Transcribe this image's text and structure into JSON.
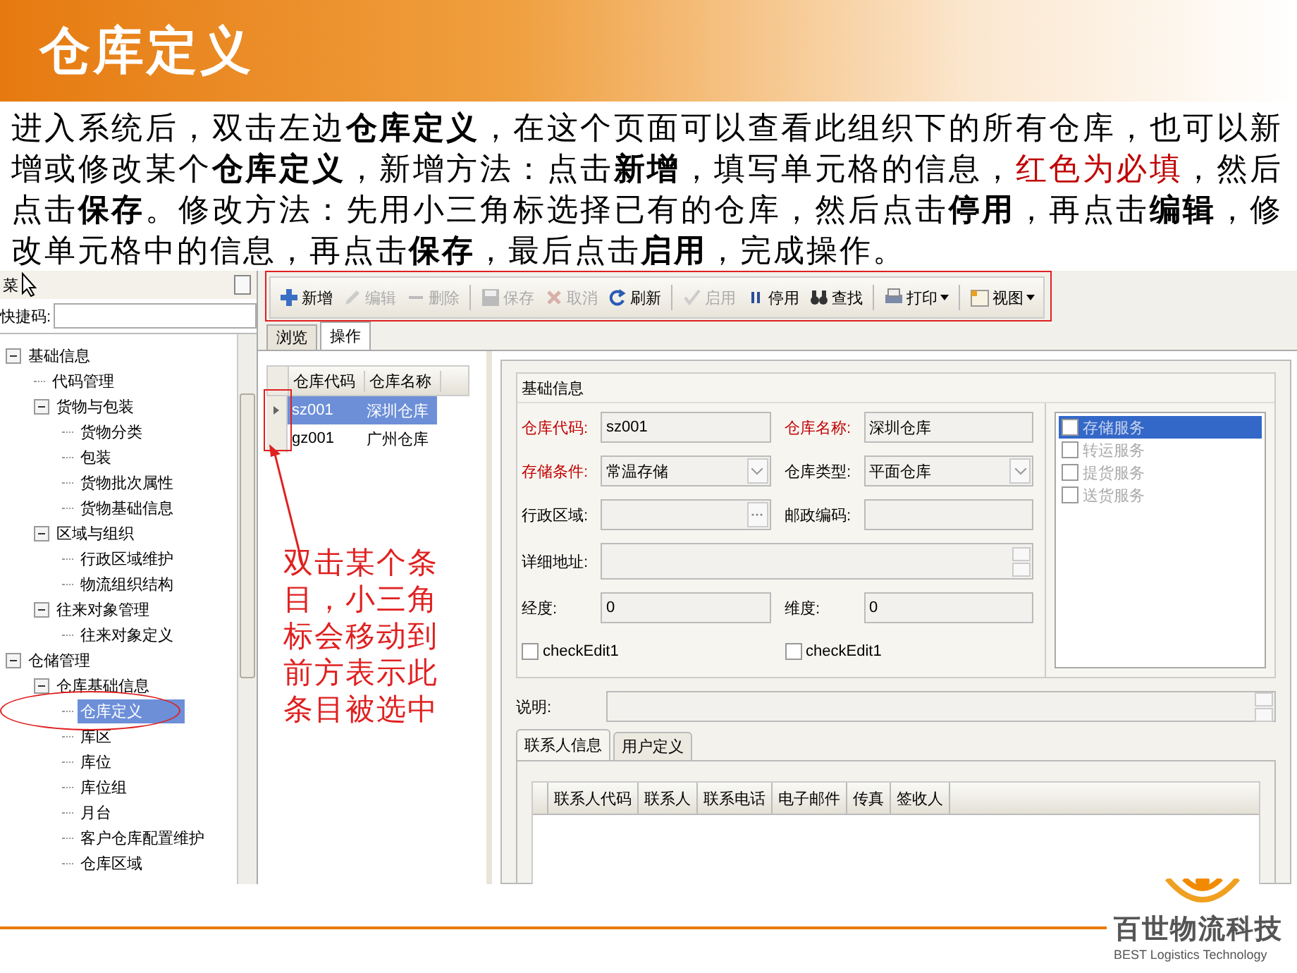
{
  "slide_title": "仓库定义",
  "instructions": [
    {
      "kind": "normal",
      "text": "进入系统后，双击左边**仓库定义**，在这个页面可以查看此组织下的所有仓库，也可以新增或修改某个**仓库定义**，新增方法：点击**新增**，填写单元格的信息，"
    },
    {
      "kind": "required",
      "text": "红色为必填"
    },
    {
      "kind": "normal",
      "text": "，然后点击**保存**。修改方法：先用小三角标选择已有的仓库，然后点击**停用**，再点击**编辑**，修改单元格中的信息，再点击**保存**，最后点击**启用**，完成操作。"
    }
  ],
  "sidebar": {
    "title": "菜",
    "shortcut_label": "快捷码:",
    "tree": [
      {
        "label": "基础信息",
        "expanded": true,
        "selected": false,
        "children": [
          {
            "label": "代码管理",
            "selected": false
          },
          {
            "label": "货物与包装",
            "expanded": true,
            "selected": false,
            "children": [
              {
                "label": "货物分类",
                "selected": false
              },
              {
                "label": "包装",
                "selected": false
              },
              {
                "label": "货物批次属性",
                "selected": false
              },
              {
                "label": "货物基础信息",
                "selected": false
              }
            ]
          },
          {
            "label": "区域与组织",
            "expanded": true,
            "selected": false,
            "children": [
              {
                "label": "行政区域维护",
                "selected": false
              },
              {
                "label": "物流组织结构",
                "selected": false
              }
            ]
          },
          {
            "label": "往来对象管理",
            "expanded": true,
            "selected": false,
            "children": [
              {
                "label": "往来对象定义",
                "selected": false
              }
            ]
          }
        ]
      },
      {
        "label": "仓储管理",
        "expanded": true,
        "selected": false,
        "children": [
          {
            "label": "仓库基础信息",
            "expanded": true,
            "selected": false,
            "children": [
              {
                "label": "仓库定义",
                "selected": true
              },
              {
                "label": "库区",
                "selected": false
              },
              {
                "label": "库位",
                "selected": false
              },
              {
                "label": "库位组",
                "selected": false
              },
              {
                "label": "月台",
                "selected": false
              },
              {
                "label": "客户仓库配置维护",
                "selected": false
              },
              {
                "label": "仓库区域",
                "selected": false
              }
            ]
          }
        ]
      }
    ]
  },
  "toolbar": [
    {
      "kind": "plus",
      "label": "新增",
      "disabled": false
    },
    {
      "kind": "pencil",
      "label": "编辑",
      "disabled": true
    },
    {
      "kind": "minus",
      "label": "删除",
      "disabled": true
    },
    {
      "kind": "separator"
    },
    {
      "kind": "save",
      "label": "保存",
      "disabled": true
    },
    {
      "kind": "cancel",
      "label": "取消",
      "disabled": true
    },
    {
      "kind": "refresh",
      "label": "刷新",
      "disabled": false
    },
    {
      "kind": "separator"
    },
    {
      "kind": "check",
      "label": "启用",
      "disabled": true
    },
    {
      "kind": "pause",
      "label": "停用",
      "disabled": false
    },
    {
      "kind": "binoculars",
      "label": "查找",
      "disabled": false
    },
    {
      "kind": "separator"
    },
    {
      "kind": "printer",
      "label": "打印",
      "disabled": false
    },
    {
      "kind": "separator"
    },
    {
      "kind": "view",
      "label": "视图",
      "disabled": false
    }
  ],
  "tabs": [
    {
      "label": "浏览",
      "selected": false
    },
    {
      "label": "操作",
      "selected": true
    }
  ],
  "warehouse_grid": {
    "columns": [
      "仓库代码",
      "仓库名称"
    ],
    "rows": [
      {
        "cells": [
          "sz001",
          "深圳仓库"
        ],
        "selected": true
      },
      {
        "cells": [
          "gz001",
          "广州仓库"
        ],
        "selected": false
      }
    ]
  },
  "basic_info": {
    "title": "基础信息",
    "fields": [
      {
        "kind": "text",
        "label": "仓库代码:",
        "required": true,
        "value": "sz001"
      },
      {
        "kind": "text",
        "label": "仓库名称:",
        "required": true,
        "value": "深圳仓库"
      },
      {
        "kind": "dropdown",
        "label": "存储条件:",
        "required": true,
        "value": "常温存储"
      },
      {
        "kind": "dropdown",
        "label": "仓库类型:",
        "required": false,
        "value": "平面仓库"
      },
      {
        "kind": "lookup",
        "label": "行政区域:",
        "required": false
      },
      {
        "kind": "text",
        "label": "邮政编码:",
        "required": false
      },
      {
        "kind": "memo",
        "label": "详细地址:",
        "required": false
      },
      {
        "kind": "text",
        "label": "经度:",
        "required": false,
        "value": "0"
      },
      {
        "kind": "text",
        "label": "维度:",
        "required": false,
        "value": "0"
      }
    ],
    "check_edits": [
      {
        "label": "checkEdit1",
        "checked": false
      },
      {
        "label": "checkEdit1",
        "checked": false
      }
    ],
    "services": [
      {
        "label": "存储服务",
        "checked": false,
        "selected": true
      },
      {
        "label": "转运服务",
        "checked": false,
        "selected": false
      },
      {
        "label": "提货服务",
        "checked": false,
        "selected": false
      },
      {
        "label": "送货服务",
        "checked": false,
        "selected": false
      }
    ]
  },
  "description_label": "说明:",
  "detail_tabs": [
    {
      "label": "联系人信息",
      "selected": true
    },
    {
      "label": "用户定义",
      "selected": false
    }
  ],
  "contact_grid": {
    "columns": [
      "联系人代码",
      "联系人",
      "联系电话",
      "电子邮件",
      "传真",
      "签收人"
    ]
  },
  "callout": "双击某个条目，小三角标会移动到前方表示此条目被选中",
  "logo": {
    "name": "百世物流科技",
    "tagline": "BEST Logistics Technology"
  }
}
